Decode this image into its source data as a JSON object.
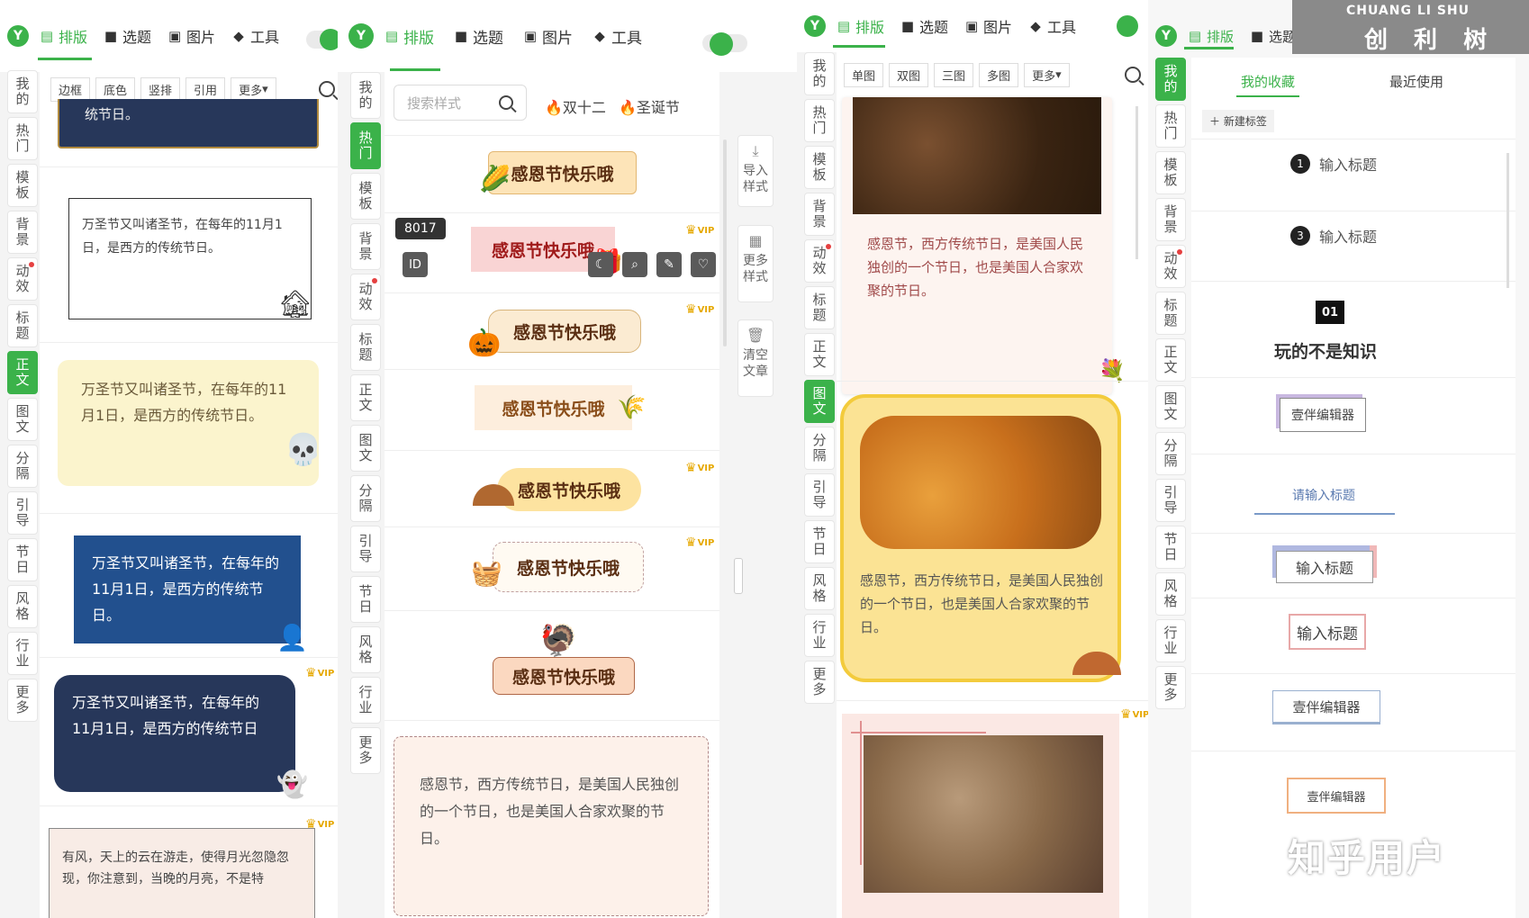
{
  "tabs": [
    {
      "label": "排版",
      "icon": "layout-icon"
    },
    {
      "label": "选题",
      "icon": "bookmark-icon"
    },
    {
      "label": "图片",
      "icon": "image-icon"
    },
    {
      "label": "工具",
      "icon": "cube-icon"
    }
  ],
  "sidebar_labels": [
    "我的",
    "热门",
    "模板",
    "背景",
    "动效",
    "标题",
    "正文",
    "图文",
    "分隔",
    "引导",
    "节日",
    "风格",
    "行业",
    "更多"
  ],
  "p1": {
    "subtabs": [
      "边框",
      "底色",
      "竖排",
      "引用",
      "更多"
    ],
    "top_text": "统节日。",
    "card1": "万圣节又叫诸圣节，在每年的11月1日，是西方的传统节日。",
    "card2": "万圣节又叫诸圣节，在每年的11月1日，是西方的传统节日。",
    "card3": "万圣节又叫诸圣节，在每年的11月1日，是西方的传统节日。",
    "card4": "万圣节又叫诸圣节，在每年的11月1日，是西方的传统节日",
    "card5": "有风，天上的云在游走，使得月光忽隐忽现，你注意到，当晚的月亮，不是特",
    "vip": "VIP"
  },
  "p2": {
    "search_placeholder": "搜索样式",
    "tags": [
      "双十二",
      "圣诞节"
    ],
    "title_text": "感恩节快乐哦",
    "tooltip": "8017",
    "id_label": "ID",
    "tools": [
      {
        "icon": "import-icon",
        "label": "导入样式"
      },
      {
        "icon": "grid-icon",
        "label": "更多样式"
      },
      {
        "icon": "trash-icon",
        "label": "清空文章"
      }
    ],
    "para": "感恩节，西方传统节日，是美国人民独创的一个节日，也是美国人合家欢聚的节日。",
    "vip": "VIP"
  },
  "p3": {
    "subtabs": [
      "单图",
      "双图",
      "三图",
      "多图",
      "更多"
    ],
    "para1": "感恩节，西方传统节日，是美国人民独创的一个节日，也是美国人合家欢聚的节日。",
    "para2": "感恩节，西方传统节日，是美国人民独创的一个节日，也是美国人合家欢聚的节日。",
    "vip": "VIP"
  },
  "p4": {
    "tab_favorites": "我的收藏",
    "tab_recent": "最近使用",
    "new_tag": "新建标签",
    "item1_num": "1",
    "item1_text": "输入标题",
    "item2_num": "3",
    "item2_text": "输入标题",
    "item3_num": "01",
    "item3_text": "玩的不是知识",
    "item4_text": "壹伴编辑器",
    "item5_text": "请输入标题",
    "item6_text": "输入标题",
    "item7_text": "输入标题",
    "item8_text": "壹伴编辑器",
    "item9_text": "壹伴编辑器"
  },
  "watermarks": {
    "top_en": "CHUANG LI SHU",
    "top_cn": "创 利 树",
    "bottom": "知乎用户"
  }
}
